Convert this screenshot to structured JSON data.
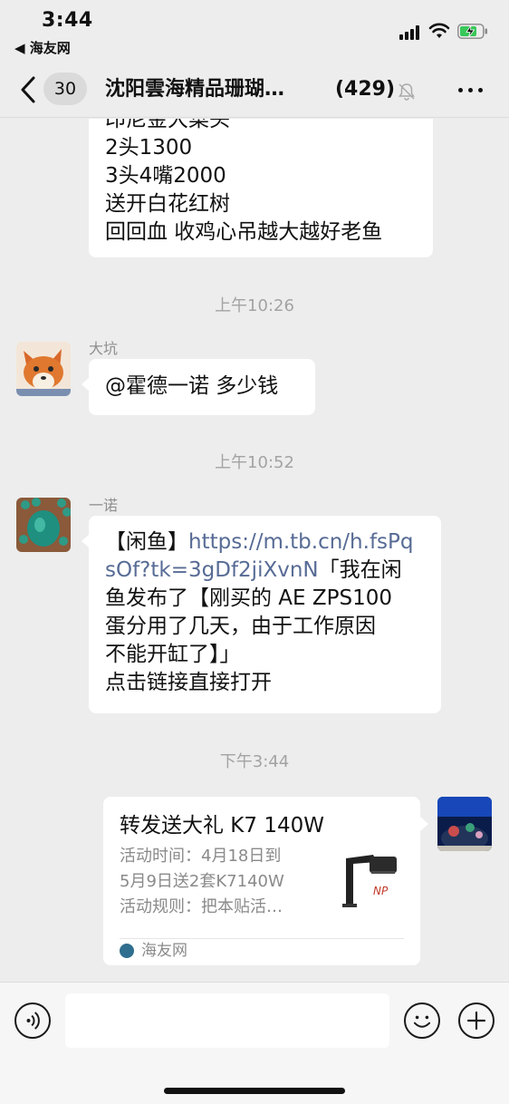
{
  "status_bar": {
    "time": "3:44",
    "back_app": "◀ 海友网"
  },
  "nav": {
    "unread_count": "30",
    "title": "沈阳雲海精品珊瑚…",
    "member_count": "(429)"
  },
  "messages": [
    {
      "type": "text",
      "lines": [
        "印尼金大菜头",
        "2头1300",
        "3头4嘴2000",
        "送开白花红树",
        "回回血 收鸡心吊越大越好老鱼"
      ]
    },
    {
      "type": "timestamp",
      "text": "上午10:26"
    },
    {
      "type": "text",
      "sender": "大坑",
      "lines": [
        "@霍德一诺 多少钱"
      ]
    },
    {
      "type": "timestamp",
      "text": "上午10:52"
    },
    {
      "type": "text",
      "sender": "一诺",
      "line1_prefix": "【闲鱼】",
      "line1_link": "https://m.tb.cn/h.fsPq",
      "line2_link": "sOf?tk=3gDf2jiXvnN",
      "line2_rest": "「我在闲",
      "lines": [
        "鱼发布了【刚买的 AE ZPS100",
        "蛋分用了几天，由于工作原因",
        "不能开缸了】」",
        "点击链接直接打开"
      ]
    },
    {
      "type": "timestamp",
      "text": "下午3:44"
    },
    {
      "type": "share_card",
      "title": "转发送大礼 K7 140W",
      "desc_lines": [
        "活动时间：4月18日到",
        "5月9日送2套K7140W",
        "活动规则：把本贴活…"
      ],
      "source": "海友网"
    }
  ],
  "colors": {
    "background": "#ededed",
    "bubble": "#ffffff",
    "link": "#576b95",
    "timestamp": "#a3a3a3"
  },
  "icons": [
    "back-chevron-icon",
    "mute-bell-icon",
    "more-dots-icon",
    "voice-icon",
    "emoji-icon",
    "plus-icon"
  ]
}
